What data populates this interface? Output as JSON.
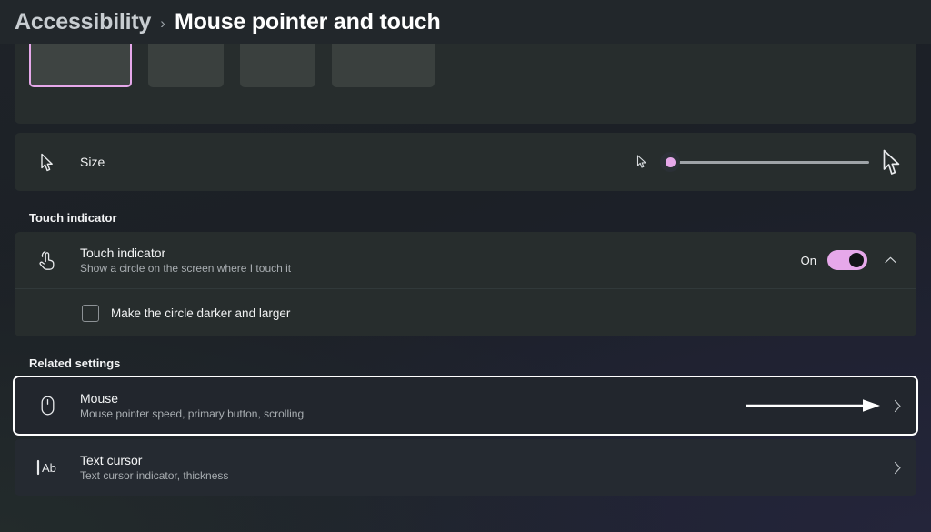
{
  "header": {
    "breadcrumb_root": "Accessibility",
    "breadcrumb_separator": "›",
    "breadcrumb_leaf": "Mouse pointer and touch"
  },
  "pointer_style": {
    "tiles": [
      {
        "name": "white-pointer",
        "selected": true,
        "preview": "cursor"
      },
      {
        "name": "black-pointer",
        "selected": false,
        "preview": "cursor"
      },
      {
        "name": "inverted-pointer",
        "selected": false,
        "preview": "blackbox"
      },
      {
        "name": "custom-color-pointer",
        "selected": false,
        "preview": "green-dot"
      }
    ]
  },
  "size_row": {
    "icon": "mouse-pointer-icon",
    "label": "Size",
    "slider": {
      "value": 1,
      "min": 1,
      "max": 15,
      "small_icon": "small-cursor-icon",
      "large_icon": "large-cursor-icon"
    }
  },
  "touch_indicator": {
    "section_title": "Touch indicator",
    "row": {
      "icon": "touch-tap-icon",
      "title": "Touch indicator",
      "subtitle": "Show a circle on the screen where I touch it",
      "toggle_state": "On",
      "toggle_on": true,
      "expander_icon": "chevron-up-icon"
    },
    "checkbox": {
      "label": "Make the circle darker and larger",
      "checked": false
    }
  },
  "related_settings": {
    "section_title": "Related settings",
    "items": [
      {
        "icon": "mouse-device-icon",
        "title": "Mouse",
        "subtitle": "Mouse pointer speed, primary button, scrolling",
        "focused": true,
        "annotation_arrow": true,
        "chevron": "chevron-right-icon"
      },
      {
        "icon": "text-cursor-icon",
        "title": "Text cursor",
        "subtitle": "Text cursor indicator, thickness",
        "focused": false,
        "annotation_arrow": false,
        "chevron": "chevron-right-icon"
      }
    ]
  },
  "colors": {
    "accent": "#e6a8ea",
    "card": "#272d2d",
    "related_card": "#252a31",
    "header_bg": "#22272b",
    "focus_ring": "#ffffff",
    "custom_pointer_dot": "#c9e03a"
  }
}
